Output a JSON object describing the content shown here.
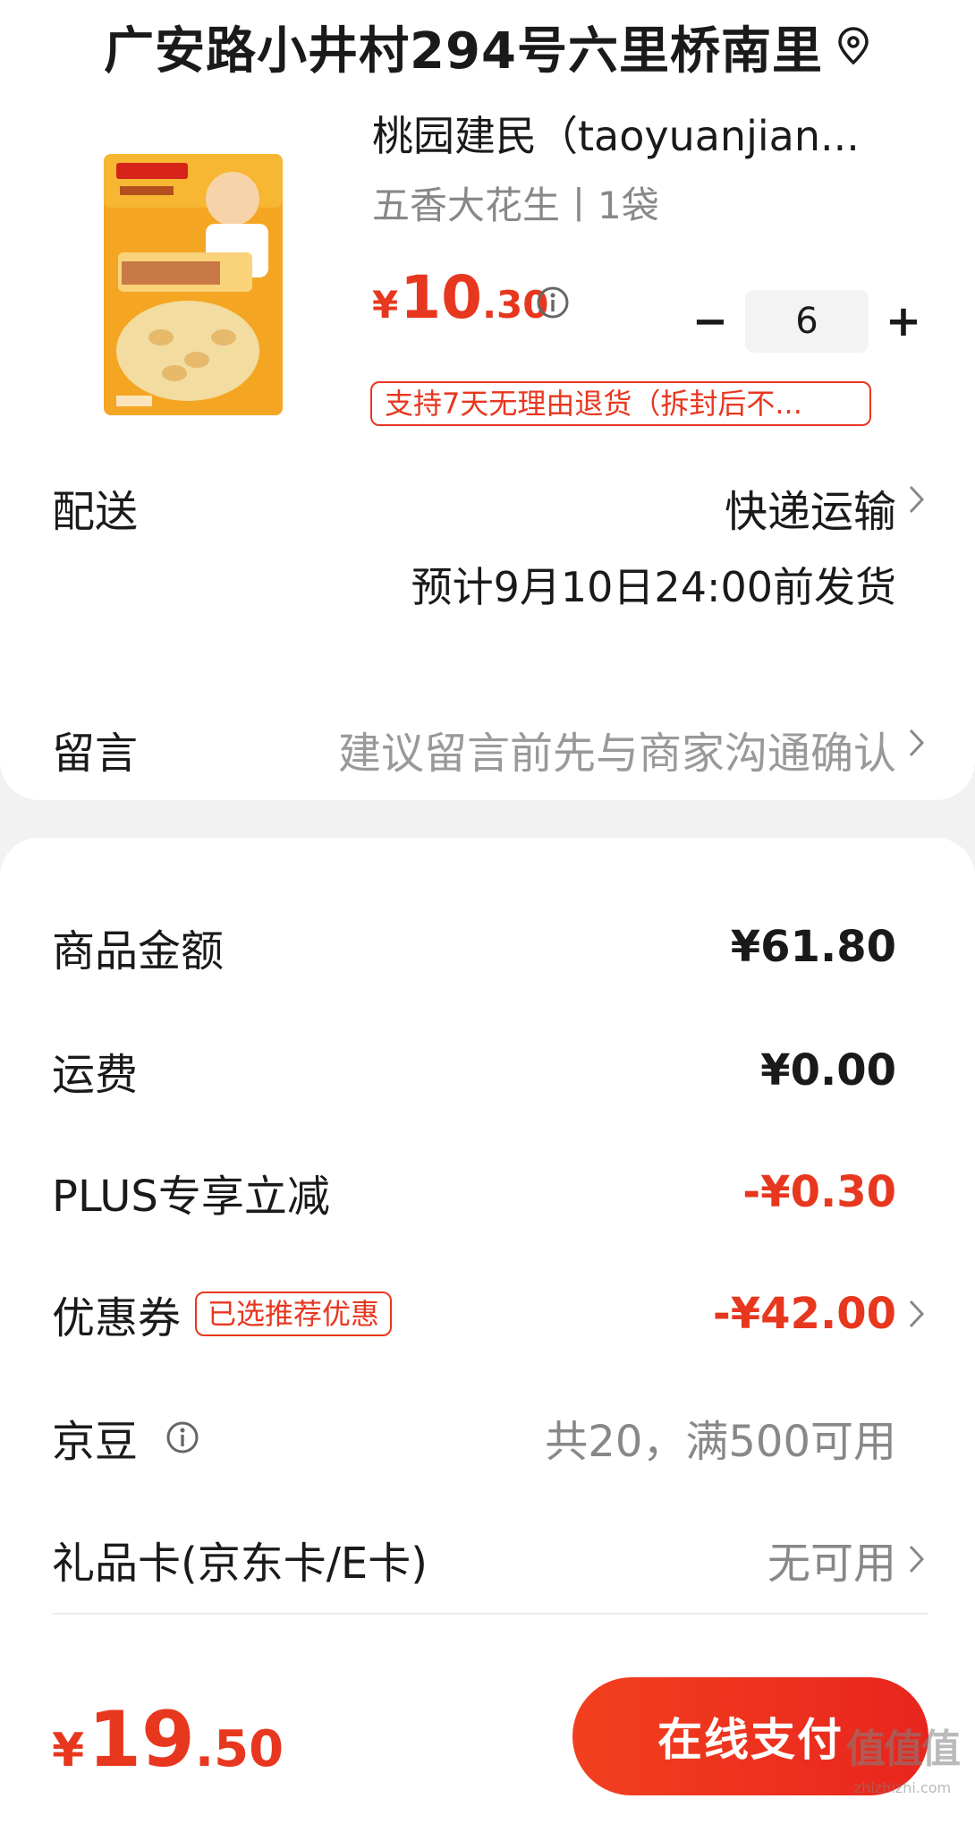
{
  "header": {
    "address": "广安路小井村294号六里桥南里",
    "location_icon": "location-pin-icon"
  },
  "product": {
    "title": "桃园建民（taoyuanjian...",
    "spec": "五香大花生丨1袋",
    "price_currency": "¥",
    "price_integer": "10",
    "price_decimal": ".30",
    "quantity": "6",
    "minus_label": "−",
    "plus_label": "+",
    "return_policy": "支持7天无理由退货（拆封后不..."
  },
  "delivery": {
    "label": "配送",
    "method": "快递运输",
    "eta": "预计9月10日24:00前发货"
  },
  "message": {
    "label": "留言",
    "placeholder": "建议留言前先与商家沟通确认"
  },
  "fees": {
    "goods_label": "商品金额",
    "goods_value": "¥61.80",
    "shipping_label": "运费",
    "shipping_value": "¥0.00",
    "plus_label": "PLUS专享立减",
    "plus_value": "-¥0.30",
    "coupon_label": "优惠券",
    "coupon_tag": "已选推荐优惠",
    "coupon_value": "-¥42.00",
    "beans_label": "京豆",
    "beans_value": "共20，满500可用",
    "giftcard_label": "礼品卡(京东卡/E卡)",
    "giftcard_value": "无可用"
  },
  "footer": {
    "total_currency": "¥",
    "total_integer": "19",
    "total_decimal": ".50",
    "pay_label": "在线支付"
  },
  "watermark": {
    "main": "值值值",
    "url": "zhizhizhi.com"
  },
  "colors": {
    "accent": "#e8371f",
    "muted": "#888888",
    "background": "#f2f2f2"
  }
}
